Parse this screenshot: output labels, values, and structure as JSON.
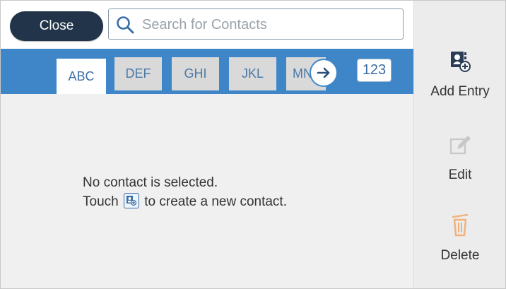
{
  "header": {
    "close_label": "Close",
    "search_placeholder": "Search for Contacts"
  },
  "tabs": [
    {
      "label": "ABC",
      "active": true
    },
    {
      "label": "DEF",
      "active": false
    },
    {
      "label": "GHI",
      "active": false
    },
    {
      "label": "JKL",
      "active": false
    },
    {
      "label": "MN",
      "active": false
    }
  ],
  "tab_numeric_label": "123",
  "content": {
    "line1": "No contact is selected.",
    "line2_prefix": "Touch",
    "line2_suffix": "to create a new contact."
  },
  "actions": {
    "add_entry": "Add Entry",
    "edit": "Edit",
    "delete": "Delete"
  },
  "colors": {
    "tab_bar": "#3f86c9",
    "close_button": "#22344a",
    "delete_icon": "#f2b07a"
  }
}
